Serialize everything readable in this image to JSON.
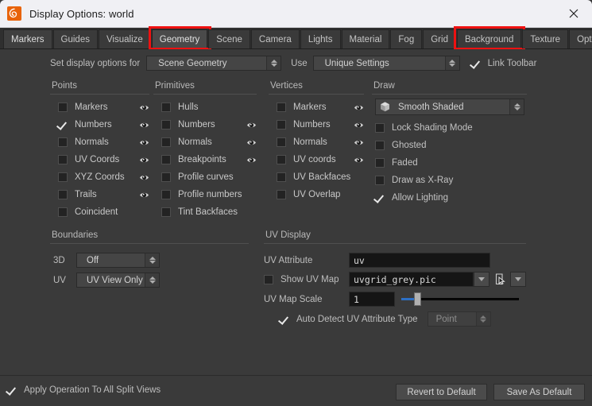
{
  "window": {
    "title": "Display Options:  world",
    "logo_icon": "houdini-logo-icon",
    "close_icon": "close-icon"
  },
  "tabs": {
    "items": [
      {
        "label": "Markers",
        "state": "selected"
      },
      {
        "label": "Guides",
        "state": "normal"
      },
      {
        "label": "Visualize",
        "state": "normal"
      },
      {
        "label": "Geometry",
        "state": "active",
        "highlight": true
      },
      {
        "label": "Scene",
        "state": "normal"
      },
      {
        "label": "Camera",
        "state": "normal"
      },
      {
        "label": "Lights",
        "state": "normal"
      },
      {
        "label": "Material",
        "state": "normal"
      },
      {
        "label": "Fog",
        "state": "normal"
      },
      {
        "label": "Grid",
        "state": "normal"
      },
      {
        "label": "Background",
        "state": "normal",
        "highlight": true
      },
      {
        "label": "Texture",
        "state": "normal"
      },
      {
        "label": "Optimize",
        "state": "normal"
      }
    ],
    "info_icon": "info-icon",
    "help_icon": "help-icon",
    "highlight_color": "#ee1111"
  },
  "toolbar": {
    "set_display_label": "Set display options for",
    "scope_value": "Scene Geometry",
    "use_label": "Use",
    "settings_value": "Unique Settings",
    "link_toolbar_label": "Link Toolbar",
    "link_toolbar_checked": true
  },
  "points": {
    "title": "Points",
    "rows": [
      {
        "label": "Markers",
        "checked": false,
        "eye": true
      },
      {
        "label": "Numbers",
        "checked": true,
        "eye": true
      },
      {
        "label": "Normals",
        "checked": false,
        "eye": true
      },
      {
        "label": "UV Coords",
        "checked": false,
        "eye": true
      },
      {
        "label": "XYZ Coords",
        "checked": false,
        "eye": true
      },
      {
        "label": "Trails",
        "checked": false,
        "eye": true
      },
      {
        "label": "Coincident",
        "checked": false,
        "eye": false
      }
    ]
  },
  "primitives": {
    "title": "Primitives",
    "rows": [
      {
        "label": "Hulls",
        "checked": false,
        "eye": false
      },
      {
        "label": "Numbers",
        "checked": false,
        "eye": true
      },
      {
        "label": "Normals",
        "checked": false,
        "eye": true
      },
      {
        "label": "Breakpoints",
        "checked": false,
        "eye": true
      },
      {
        "label": "Profile curves",
        "checked": false,
        "eye": false
      },
      {
        "label": "Profile numbers",
        "checked": false,
        "eye": false
      },
      {
        "label": "Tint Backfaces",
        "checked": false,
        "eye": false
      }
    ]
  },
  "vertices": {
    "title": "Vertices",
    "rows": [
      {
        "label": "Markers",
        "checked": false,
        "eye": true
      },
      {
        "label": "Numbers",
        "checked": false,
        "eye": true
      },
      {
        "label": "Normals",
        "checked": false,
        "eye": true
      },
      {
        "label": "UV coords",
        "checked": false,
        "eye": true
      },
      {
        "label": "UV Backfaces",
        "checked": false,
        "eye": false
      },
      {
        "label": "UV Overlap",
        "checked": false,
        "eye": false
      }
    ]
  },
  "draw": {
    "title": "Draw",
    "shading_value": "Smooth Shaded",
    "shading_icon": "cube-icon",
    "rows": [
      {
        "label": "Lock Shading Mode",
        "checked": false
      },
      {
        "label": "Ghosted",
        "checked": false
      },
      {
        "label": "Faded",
        "checked": false
      },
      {
        "label": "Draw as X-Ray",
        "checked": false
      },
      {
        "label": "Allow Lighting",
        "checked": true
      }
    ]
  },
  "boundaries": {
    "title": "Boundaries",
    "rows": [
      {
        "label": "3D",
        "value": "Off"
      },
      {
        "label": "UV",
        "value": "UV View Only"
      }
    ]
  },
  "uv_display": {
    "title": "UV Display",
    "attribute_label": "UV Attribute",
    "attribute_value": "uv",
    "show_uv_map_label": "Show UV Map",
    "show_uv_map_checked": false,
    "uv_map_value": "uvgrid_grey.pic",
    "file_browse_icon": "file-chooser-icon",
    "menu_icon": "chevron-down-icon",
    "map_scale_label": "UV Map Scale",
    "map_scale_value": "1",
    "map_scale_percent": 2,
    "auto_detect_label": "Auto Detect UV Attribute Type",
    "auto_detect_checked": true,
    "attr_type_value": "Point"
  },
  "footer": {
    "apply_all_label": "Apply Operation To All Split Views",
    "apply_all_checked": true,
    "revert_label": "Revert to Default",
    "save_label": "Save As Default"
  }
}
